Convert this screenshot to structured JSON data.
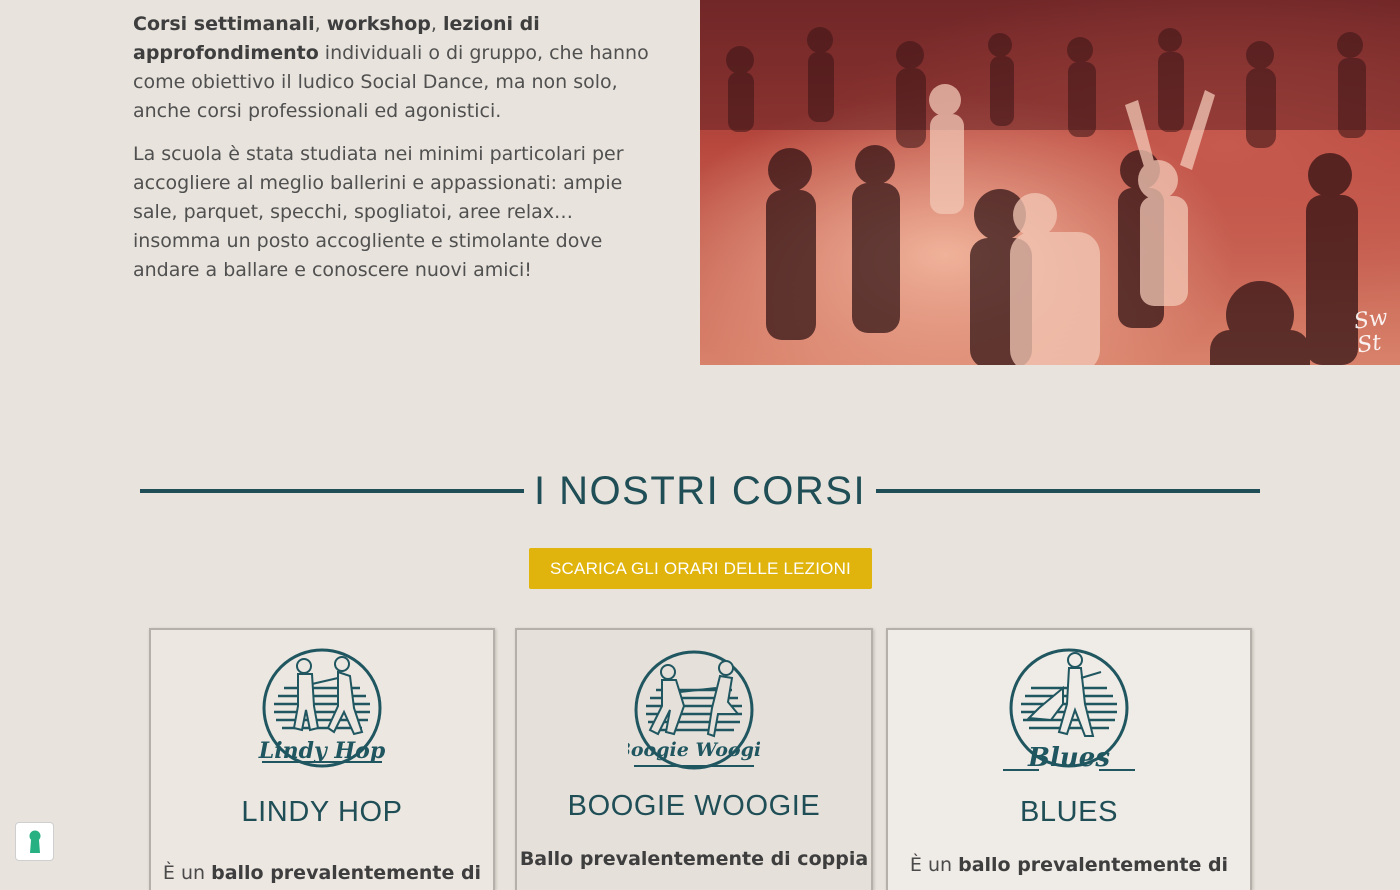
{
  "intro": {
    "p1_bold1": "Corsi settimanali",
    "p1_sep1": ", ",
    "p1_bold2": "workshop",
    "p1_sep2": ", ",
    "p1_bold3": "lezioni di approfondimento",
    "p1_rest": " individuali o di gruppo, che hanno come obiettivo il ludico Social Dance, ma non solo, anche corsi professionali ed agonistici.",
    "p2": "La scuola è stata studiata nei minimi particolari per accogliere al meglio ballerini e appassionati: ampie sale, parquet, specchi, spogliatoi, aree relax… insomma un posto accogliente e stimolante dove andare a ballare e conoscere nuovi amici!"
  },
  "photo": {
    "watermark": "Sw St"
  },
  "courses_section": {
    "heading": "I NOSTRI CORSI",
    "download_label": "SCARICA GLI ORARI DELLE LEZIONI"
  },
  "courses": [
    {
      "logo_text": "Lindy Hop",
      "title": "LINDY HOP",
      "desc_prefix": "È un ",
      "desc_bold": "ballo prevalentemente di"
    },
    {
      "logo_text": "Boogie Woogie",
      "title": "BOOGIE WOOGIE",
      "desc_prefix": "",
      "desc_bold": "Ballo prevalentemente di coppia"
    },
    {
      "logo_text": "Blues",
      "title": "BLUES",
      "desc_prefix": "È un ",
      "desc_bold": "ballo prevalentemente di"
    }
  ],
  "colors": {
    "background": "#e8e3dc",
    "brand_teal": "#1f4e56",
    "button_yellow": "#e0b40c",
    "accessibility_green": "#27b082"
  },
  "icons": {
    "accessibility": "keyhole-accessibility-icon"
  }
}
